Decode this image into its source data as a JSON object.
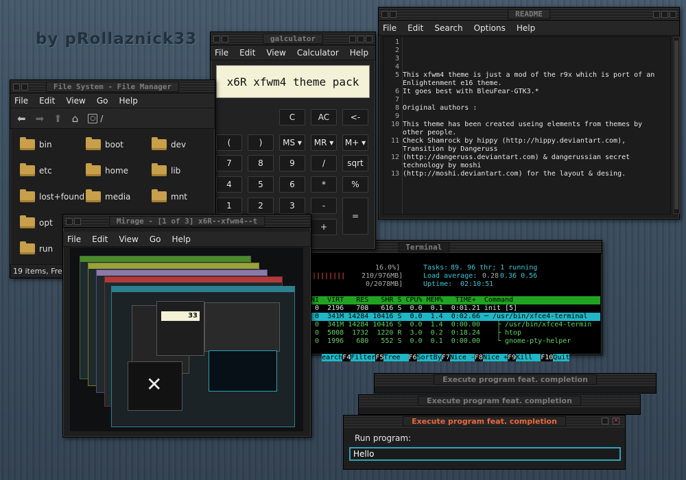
{
  "watermark": "by pRollaznick33",
  "file_manager": {
    "title": "File System - File Manager",
    "menu": [
      "File",
      "Edit",
      "View",
      "Go",
      "Help"
    ],
    "path": "/",
    "items": [
      "bin",
      "boot",
      "dev",
      "etc",
      "home",
      "lib",
      "lost+found",
      "media",
      "mnt",
      "opt",
      "run"
    ],
    "status": "19 items, Free"
  },
  "calculator": {
    "title": "galculator",
    "menu": [
      "File",
      "Edit",
      "View",
      "Calculator",
      "Help"
    ],
    "display": "x6R xfwm4 theme pack",
    "buttons": {
      "c": "C",
      "ac": "AC",
      "back": "<-",
      "lp": "(",
      "rp": ")",
      "ms": "MS ▾",
      "mr": "MR ▾",
      "mplus": "M+ ▾",
      "b7": "7",
      "b8": "8",
      "b9": "9",
      "div": "/",
      "sqrt": "sqrt",
      "b4": "4",
      "b5": "5",
      "b6": "6",
      "mul": "*",
      "pct": "%",
      "b1": "1",
      "b2": "2",
      "b3": "3",
      "minus": "-",
      "eq": "=",
      "plus": "+"
    }
  },
  "readme": {
    "title": "README",
    "menu": [
      "File",
      "Edit",
      "Search",
      "Options",
      "Help"
    ],
    "line_numbers": [
      "1",
      "2",
      "3",
      "4",
      "5",
      "6",
      "7",
      "8",
      "9",
      "10",
      "11",
      "12",
      "13"
    ],
    "lines": [
      "This xfwm4 theme is just a mod of the r9x which is port of an Enlightenment e16 theme.",
      "It goes best with BleuFear-GTK3.*",
      "Original authors :",
      "This theme has been created useing elements from themes by other people.",
      "Check Shamrock by hippy (http://hippy.deviantart.com), Transition by Dangeruss",
      "(http://dangeruss.deviantart.com) & dangerussian secret technology by moshi",
      "(http://moshi.deviantart.com) for the layout & desing."
    ]
  },
  "terminal": {
    "title": "Terminal",
    "bar_1": "||||||||",
    "cpu_pct": "16.0%]",
    "mem": "210/976MB]",
    "swp": "0/2078MB]",
    "tasks_label": "Tasks:",
    "tasks_value": "89. 96 thr; 1 running",
    "load_label": "Load average:",
    "load_1": "0.28",
    "load_rest": "0.36 0.56",
    "uptime_label": "Uptime:",
    "uptime_value": "02:10:51",
    "header": " NI  VIRT   RES   SHR S CPU% MEM%   TIME+  Command            ",
    "rows": [
      "  0  2196   708   616 S  0.0  0.1  0:01.21 init [5]",
      "  0  341M 14284 10416 S  0.0  1.4  0:02.66 ─ /usr/bin/xfce4-terminal",
      "  0  341M 14284 10416 S  0.0  1.4  0:00.00    ├ /usr/bin/xfce4-termin",
      "  0  5008  1732  1220 R  3.0  0.2  0:18.24    ├ htop",
      "  0  1996   680   552 S  0.0  0.1  0:00.00    └ gnome-pty-helper"
    ],
    "fkeys": [
      {
        "k": "",
        "l": "earch"
      },
      {
        "k": "F4",
        "l": "Filter"
      },
      {
        "k": "F5",
        "l": "Tree  "
      },
      {
        "k": "F6",
        "l": "SortBy"
      },
      {
        "k": "F7",
        "l": "Nice -"
      },
      {
        "k": "F8",
        "l": "Nice +"
      },
      {
        "k": "F9",
        "l": "Kill  "
      },
      {
        "k": "F10",
        "l": "Quit"
      }
    ]
  },
  "mirage": {
    "title": "Mirage - [1 of 3] x6R--xfwm4--t",
    "menu": [
      "File",
      "Edit",
      "View",
      "Go",
      "Help"
    ],
    "thumb_number": "33"
  },
  "run_dialogs": {
    "title": "Execute program feat. completion",
    "label": "Run program:",
    "value": "Hello"
  },
  "colors": {
    "accent_cyan": "#1fb7c6",
    "htop_green": "#21a321",
    "active_title": "#e8683a",
    "input_border": "#2fa3c0"
  }
}
